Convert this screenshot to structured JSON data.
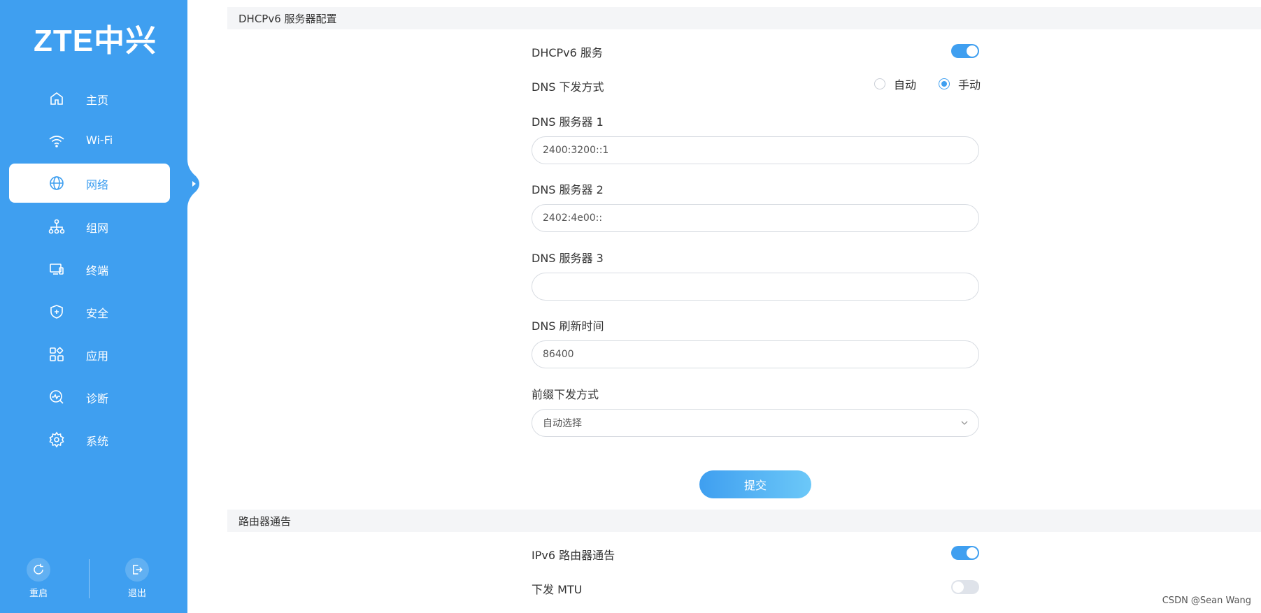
{
  "brand": {
    "logo_text": "ZTE中兴"
  },
  "sidebar": {
    "items": [
      {
        "label": "主页",
        "icon": "home-icon"
      },
      {
        "label": "Wi-Fi",
        "icon": "wifi-icon"
      },
      {
        "label": "网络",
        "icon": "globe-icon",
        "active": true
      },
      {
        "label": "组网",
        "icon": "mesh-network-icon"
      },
      {
        "label": "终端",
        "icon": "devices-icon"
      },
      {
        "label": "安全",
        "icon": "shield-icon"
      },
      {
        "label": "应用",
        "icon": "apps-icon"
      },
      {
        "label": "诊断",
        "icon": "diagnostics-icon"
      },
      {
        "label": "系统",
        "icon": "gear-icon"
      }
    ],
    "bottom": {
      "restart_label": "重启",
      "logout_label": "退出"
    }
  },
  "dhcp_section": {
    "title": "DHCPv6 服务器配置",
    "service_label": "DHCPv6 服务",
    "service_enabled": true,
    "dns_mode_label": "DNS 下发方式",
    "dns_mode_options": [
      "自动",
      "手动"
    ],
    "dns_mode_selected": "手动",
    "dns1_label": "DNS 服务器 1",
    "dns1_value": "2400:3200::1",
    "dns2_label": "DNS 服务器 2",
    "dns2_value": "2402:4e00::",
    "dns3_label": "DNS 服务器 3",
    "dns3_value": "",
    "refresh_label": "DNS 刷新时间",
    "refresh_value": "86400",
    "prefix_label": "前缀下发方式",
    "prefix_value": "自动选择",
    "submit_label": "提交"
  },
  "ra_section": {
    "title": "路由器通告",
    "ipv6_ra_label": "IPv6 路由器通告",
    "ipv6_ra_enabled": true,
    "mtu_label": "下发 MTU",
    "mtu_enabled": false
  },
  "watermark": "CSDN @Sean Wang",
  "colors": {
    "accent": "#3f9ff0",
    "section_bg": "#f4f5f7"
  }
}
